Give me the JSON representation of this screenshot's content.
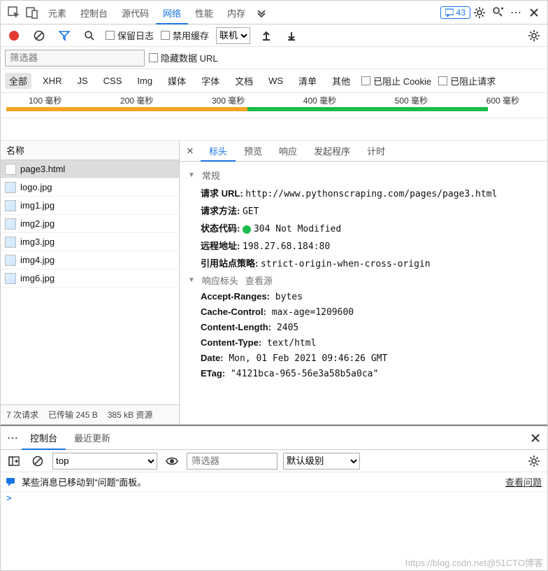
{
  "topTabs": {
    "items": [
      "元素",
      "控制台",
      "源代码",
      "网络",
      "性能",
      "内存"
    ],
    "activeIndex": 3,
    "feedbackCount": "43"
  },
  "netToolbar": {
    "preserveLog": "保留日志",
    "disableCache": "禁用缓存",
    "throttling": "联机"
  },
  "filterRow": {
    "placeholder": "筛选器",
    "hideDataUrls": "隐藏数据 URL"
  },
  "typeFilters": [
    "全部",
    "XHR",
    "JS",
    "CSS",
    "Img",
    "媒体",
    "字体",
    "文档",
    "WS",
    "清单",
    "其他"
  ],
  "blockChecks": {
    "cookie": "已阻止 Cookie",
    "requests": "已阻止请求"
  },
  "timelineTicks": [
    "100 毫秒",
    "200 毫秒",
    "300 毫秒",
    "400 毫秒",
    "500 毫秒",
    "600 毫秒"
  ],
  "nameHeader": "名称",
  "files": [
    {
      "name": "page3.html",
      "kind": "doc",
      "selected": true
    },
    {
      "name": "logo.jpg",
      "kind": "img"
    },
    {
      "name": "img1.jpg",
      "kind": "img"
    },
    {
      "name": "img2.jpg",
      "kind": "img"
    },
    {
      "name": "img3.jpg",
      "kind": "img"
    },
    {
      "name": "img4.jpg",
      "kind": "img"
    },
    {
      "name": "img6.jpg",
      "kind": "img"
    }
  ],
  "detailTabs": [
    "标头",
    "预览",
    "响应",
    "发起程序",
    "计时"
  ],
  "sections": {
    "general": "常规",
    "responseHeaders": "响应标头",
    "viewSource": "查看源"
  },
  "general": {
    "urlLabel": "请求 URL:",
    "url": "http://www.pythonscraping.com/pages/page3.html",
    "methodLabel": "请求方法:",
    "method": "GET",
    "statusLabel": "状态代码:",
    "status": "304 Not Modified",
    "remoteLabel": "远程地址:",
    "remote": "198.27.68.184:80",
    "referrerLabel": "引用站点策略:",
    "referrer": "strict-origin-when-cross-origin"
  },
  "respHeaders": [
    {
      "k": "Accept-Ranges:",
      "v": "bytes"
    },
    {
      "k": "Cache-Control:",
      "v": "max-age=1209600"
    },
    {
      "k": "Content-Length:",
      "v": "2405"
    },
    {
      "k": "Content-Type:",
      "v": "text/html"
    },
    {
      "k": "Date:",
      "v": "Mon, 01 Feb 2021 09:46:26 GMT"
    },
    {
      "k": "ETag:",
      "v": "\"4121bca-965-56e3a58b5a0ca\""
    }
  ],
  "footer": {
    "requests": "7 次请求",
    "transferred": "已传输 245 B",
    "resources": "385 kB 资源"
  },
  "drawer": {
    "tabs": [
      "控制台",
      "最近更新"
    ],
    "execContext": "top",
    "filterPlaceholder": "筛选器",
    "levels": "默认级别",
    "message": "某些消息已移动到\"问题\"面板。",
    "viewIssues": "查看问题"
  },
  "watermark": "https://blog.csdn.net@51CTO博客"
}
